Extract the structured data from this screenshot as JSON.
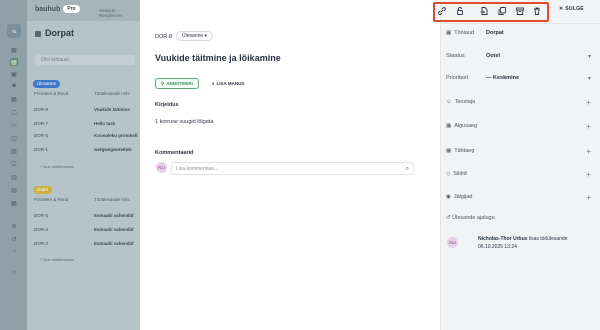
{
  "app": {
    "brand": "bauhub",
    "plan": "Pro",
    "org": "Seaside Residences"
  },
  "workspace": {
    "initials": "Ta"
  },
  "list": {
    "project": "Dorpat",
    "search_placeholder": "Otsi tööiaust",
    "groups": [
      {
        "status": "Ülesanne",
        "color": "#3f78c8",
        "cols": [
          "Prioriteet & Rood",
          "Tööülesande nimi"
        ],
        "rows": [
          [
            "DOR-8",
            "Vuukide täitmine"
          ],
          [
            "DOR-7",
            "Hello task"
          ],
          [
            "DOR-5",
            "Koosoleku protokoll"
          ],
          [
            "DOR-1",
            "wefgwegwetwtwb"
          ]
        ],
        "add": "+ Uus töölülesanne"
      },
      {
        "status": "Ootel",
        "color": "#c9b241",
        "cols": [
          "Prioriteet & Rood",
          "Tööülesande nimi"
        ],
        "rows": [
          [
            "DOR-5",
            "Esmaabi vahendid"
          ],
          [
            "DOR-4",
            "Esmaabi vahendid"
          ],
          [
            "DOR-3",
            "Esmaabi vahendid"
          ]
        ],
        "add": "+ Uus töölülesanne"
      }
    ]
  },
  "toolbar": {
    "close_label": "SULGE",
    "icons": [
      "link-icon",
      "lock-icon",
      "export-icon",
      "copy-icon",
      "archive-icon",
      "trash-icon"
    ]
  },
  "detail": {
    "id": "DOR-8",
    "status": "Ülesanne",
    "title": "Vuukide täitmine ja lõikamine",
    "annotate_label": "ANNOTEERI",
    "add_file_label": "LISA MANUS",
    "description_label": "Kirjeldus",
    "description": "1 korruse vuugid lõigata",
    "comments_label": "Kommentaarid",
    "comment_placeholder": "Lisa kommentaar...",
    "user_initials": "NU"
  },
  "side": {
    "workspace_label": "Tööiaud",
    "workspace_value": "Dorpat",
    "status_label": "Staatus",
    "status_value": "Ootel",
    "priority_label": "Prioriteet",
    "priority_value": "Keskmine",
    "fields": [
      "Teostaja",
      "Algusaeg",
      "Tähtaeg",
      "Sildid",
      "Jälgijad"
    ],
    "history_label": "Ülesande ajalugu",
    "history_user": "Nicholas-Thor Urbus",
    "history_action": "lisas tööülesande",
    "history_time": "06.10.2025 13:24",
    "history_initials": "NU"
  }
}
